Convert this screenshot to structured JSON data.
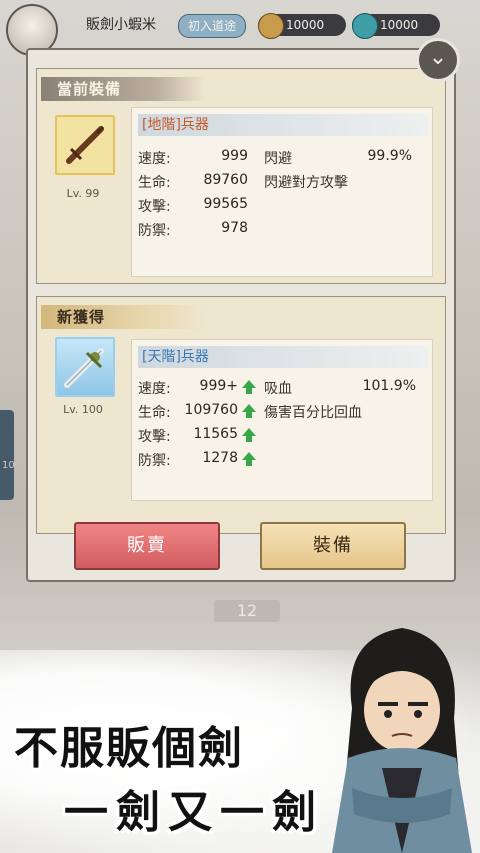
{
  "topbar": {
    "player_name": "販劍小蝦米",
    "status_tag": "初入道途",
    "coins": "10000",
    "gems": "10000"
  },
  "dialog": {
    "current": {
      "title": "當前裝備",
      "grade": "[地階]兵器",
      "level": "Lv. 99",
      "stats": [
        {
          "label": "速度:",
          "value": "999"
        },
        {
          "label": "生命:",
          "value": "89760"
        },
        {
          "label": "攻擊:",
          "value": "99565"
        },
        {
          "label": "防禦:",
          "value": "978"
        }
      ],
      "special": {
        "label": "閃避",
        "value": "99.9%",
        "desc": "閃避對方攻擊"
      }
    },
    "new": {
      "title": "新獲得",
      "grade": "[天階]兵器",
      "level": "Lv. 100",
      "stats": [
        {
          "label": "速度:",
          "value": "999+"
        },
        {
          "label": "生命:",
          "value": "109760"
        },
        {
          "label": "攻擊:",
          "value": "11565"
        },
        {
          "label": "防禦:",
          "value": "1278"
        }
      ],
      "special": {
        "label": "吸血",
        "value": "101.9%",
        "desc": "傷害百分比回血"
      }
    },
    "buttons": {
      "sell": "販賣",
      "equip": "裝備"
    }
  },
  "background": {
    "count": "12",
    "side_label": "10"
  },
  "promo": {
    "line1": "不服販個劍",
    "line2": "一劍又一劍"
  },
  "colors": {
    "upgrade_arrow": "#3aa64a",
    "sell_button": "#d25d60",
    "equip_button": "#e5c68a"
  }
}
